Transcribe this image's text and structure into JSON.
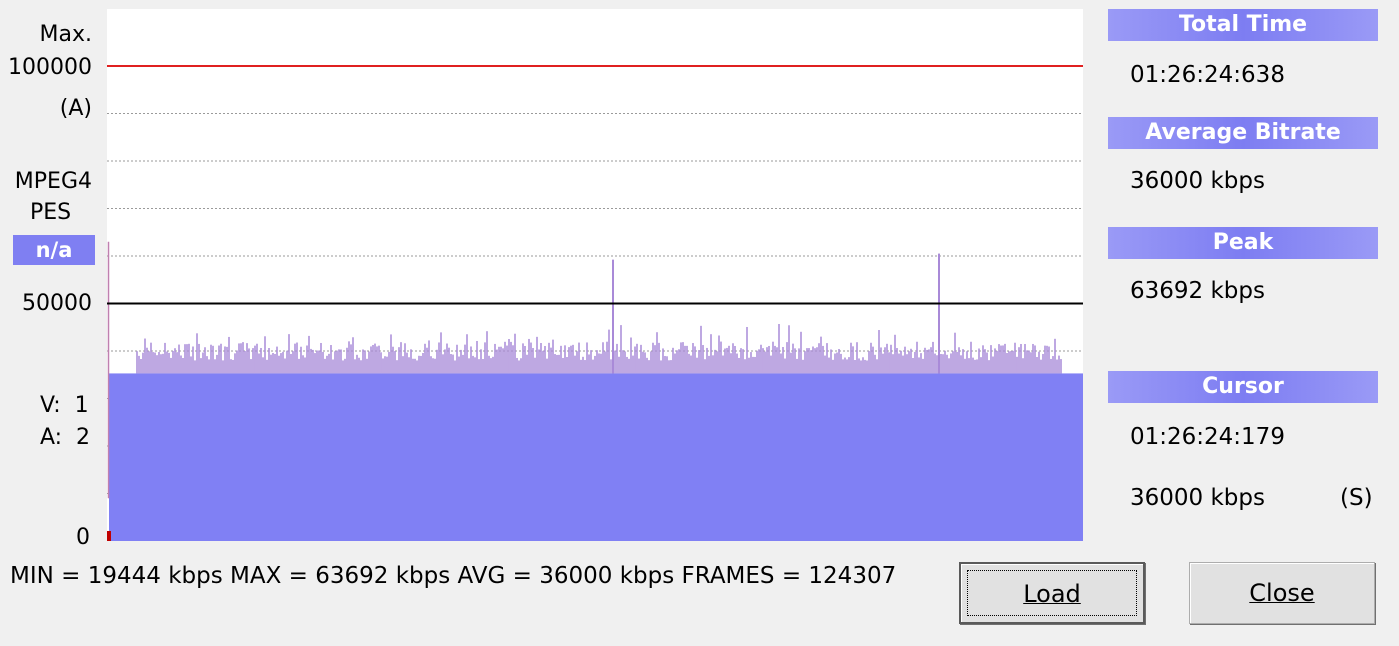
{
  "left_axis": {
    "max_label": "Max.",
    "max_value": "100000",
    "max_unit": "(A)",
    "format_line1": "MPEG4",
    "format_line2": "PES",
    "badge": "n/a",
    "mid_value": "50000",
    "video_streams": "V:  1",
    "audio_streams": "A:  2",
    "zero": "0"
  },
  "chart_data": {
    "type": "area",
    "ylim": [
      0,
      100000
    ],
    "reference_lines": [
      {
        "value": 100000,
        "color": "#e02020"
      },
      {
        "value": 50000,
        "color": "#000000"
      }
    ],
    "grid": "dotted horizontal",
    "series": [
      {
        "values_stats": {
          "min": 19444,
          "max": 63692,
          "avg": 36000,
          "frames": 124307
        }
      }
    ],
    "base_fill_color": "#8080f4",
    "spike_color": "#a98ad8"
  },
  "panel": {
    "total_time_header": "Total Time",
    "total_time_value": "01:26:24:638",
    "avg_bitrate_header": "Average Bitrate",
    "avg_bitrate_value": "36000 kbps",
    "peak_header": "Peak",
    "peak_value": "63692 kbps",
    "cursor_header": "Cursor",
    "cursor_time": "01:26:24:179",
    "cursor_bitrate": "36000 kbps",
    "cursor_suffix": "(S)"
  },
  "stats_line": "MIN = 19444 kbps  MAX = 63692 kbps  AVG = 36000 kbps  FRAMES = 124307",
  "buttons": {
    "load_label": "Load",
    "close_label": "Close"
  }
}
